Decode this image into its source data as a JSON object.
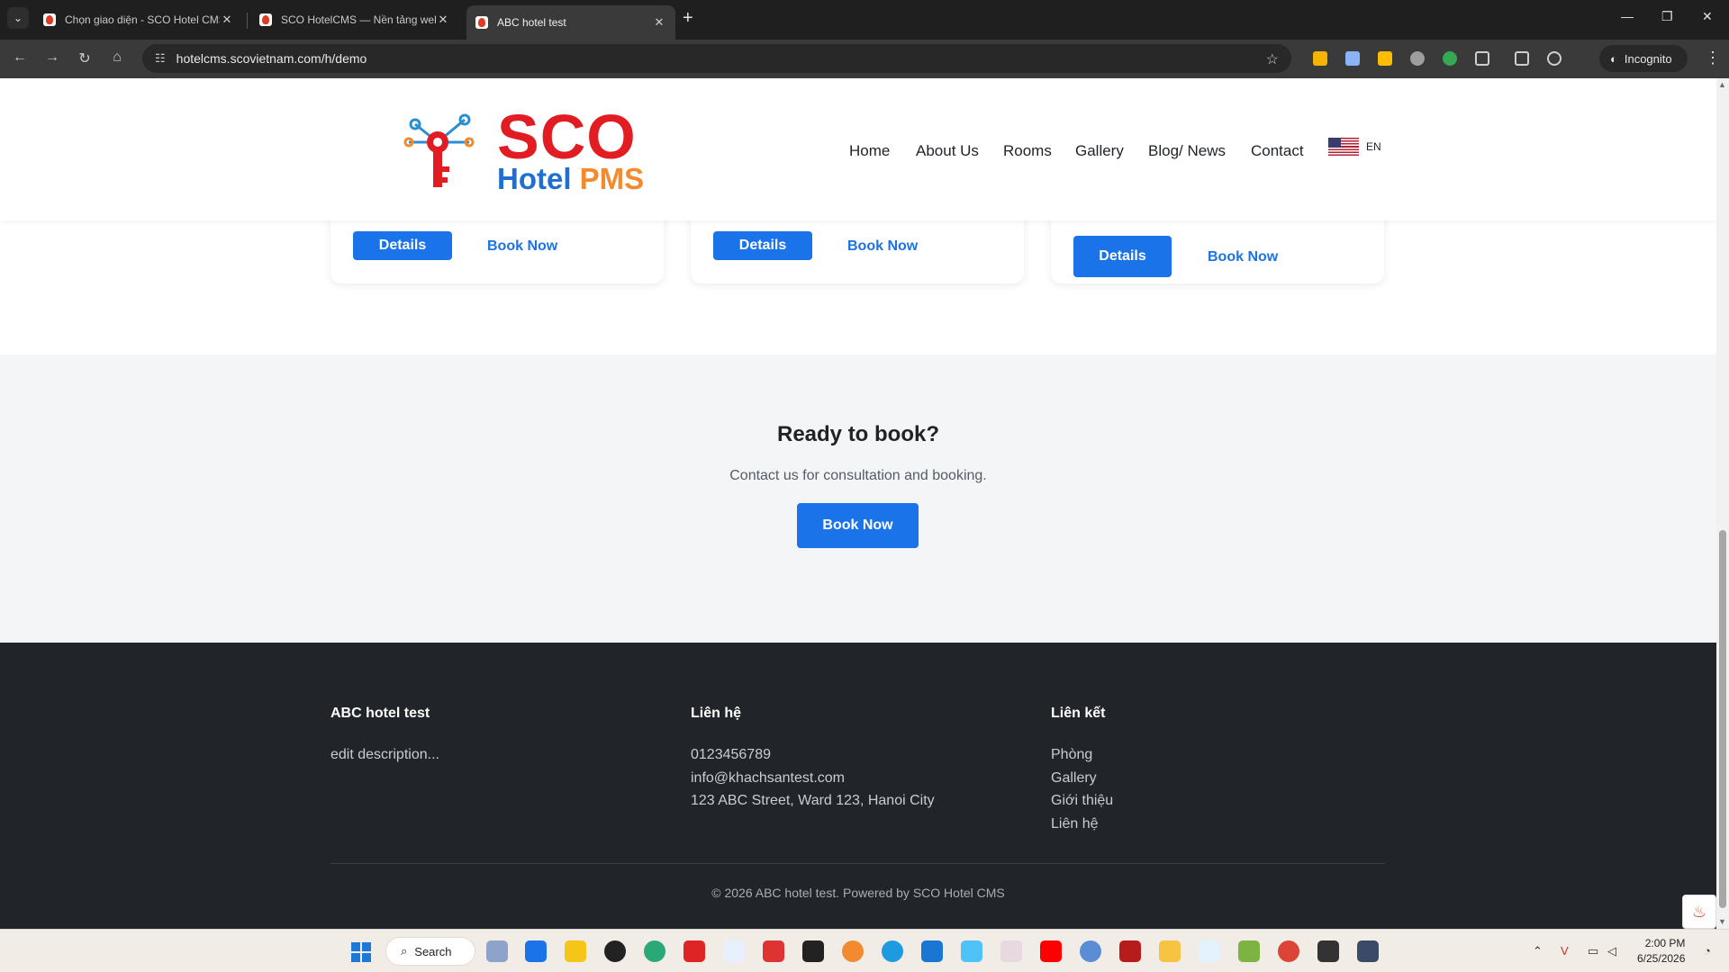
{
  "browser": {
    "tabs": [
      {
        "title": "Chọn giao diện - SCO Hotel CMS"
      },
      {
        "title": "SCO HotelCMS — Nền tảng website"
      },
      {
        "title": "ABC hotel test"
      }
    ],
    "url": "hotelcms.scovietnam.com/h/demo",
    "incognito_label": "Incognito"
  },
  "header": {
    "logo": {
      "line1": "SCO",
      "line2_a": "Hotel",
      "line2_b": "PMS"
    },
    "menu": [
      "Home",
      "About Us",
      "Rooms",
      "Gallery",
      "Blog/ News",
      "Contact"
    ],
    "lang_code": "EN"
  },
  "cards": [
    {
      "details_label": "Details",
      "book_label": "Book Now"
    },
    {
      "details_label": "Details",
      "book_label": "Book Now"
    },
    {
      "details_label": "Details",
      "book_label": "Book Now"
    }
  ],
  "cta": {
    "title": "Ready to book?",
    "subtitle": "Contact us for consultation and booking.",
    "button": "Book Now"
  },
  "footer": {
    "col1": {
      "heading": "ABC hotel test",
      "description": "edit description..."
    },
    "col2": {
      "heading": "Liên hệ",
      "phone": "0123456789",
      "email": "info@khachsantest.com",
      "address": "123 ABC Street, Ward 123, Hanoi City"
    },
    "col3": {
      "heading": "Liên kết",
      "links": [
        "Phòng",
        "Gallery",
        "Giới thiệu",
        "Liên hệ"
      ]
    },
    "copyright": "© 2026 ABC hotel test. Powered by SCO Hotel CMS"
  },
  "taskbar": {
    "search_label": "Search",
    "time": "2:00 PM",
    "date": "6/25/2026"
  },
  "colors": {
    "primary": "#1a73e8",
    "logo_red": "#e11d23",
    "logo_blue": "#1f6fd1",
    "logo_orange": "#f58a2c",
    "footer_bg": "#212529",
    "cta_bg": "#f4f5f7"
  }
}
